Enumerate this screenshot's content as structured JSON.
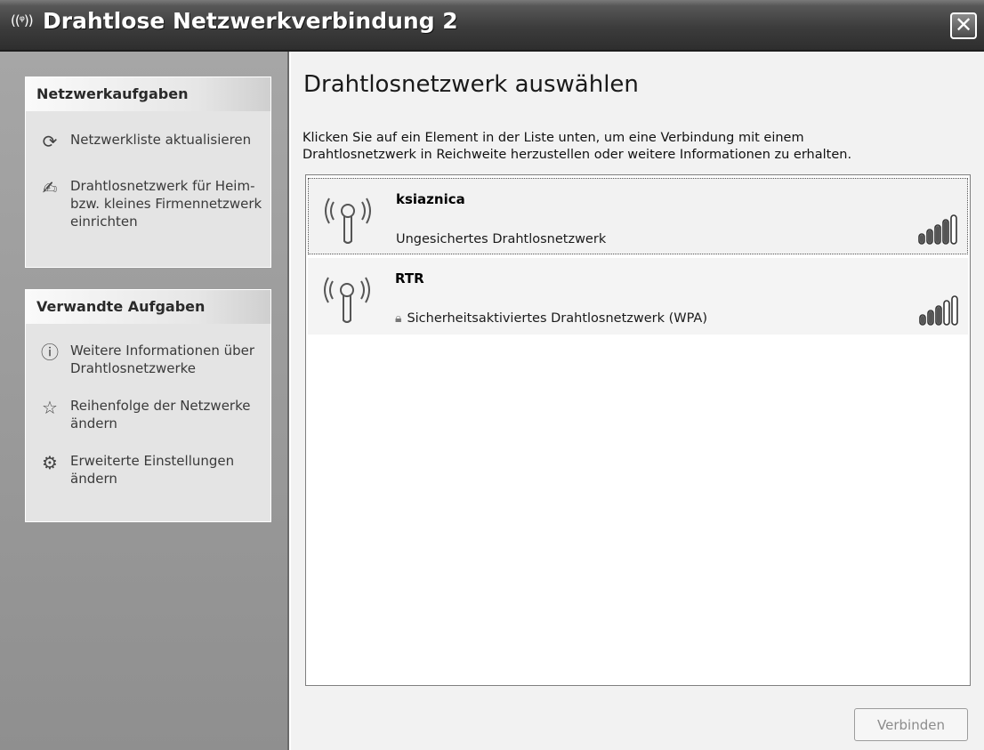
{
  "window": {
    "title": "Drahtlose Netzwerkverbindung 2",
    "title_icon": "((ᵠ))",
    "close_label": "✕"
  },
  "task_groups": [
    {
      "title": "Netzwerkaufgaben",
      "items": [
        {
          "icon": "refresh-icon",
          "glyph": "⟳",
          "label": "Netzwerkliste aktualisieren"
        },
        {
          "icon": "wireless-setup-icon",
          "glyph": "✍",
          "label": "Drahtlosnetzwerk für Heim- bzw. kleines Firmennetzwerk einrichten"
        }
      ]
    },
    {
      "title": "Verwandte Aufgaben",
      "items": [
        {
          "icon": "info-icon",
          "glyph": "ⓘ",
          "label": "Weitere Informationen über Drahtlosnetzwerke"
        },
        {
          "icon": "star-icon",
          "glyph": "☆",
          "label": "Reihenfolge der Netzwerke ändern"
        },
        {
          "icon": "settings-icon",
          "glyph": "⚙",
          "label": "Erweiterte Einstellungen ändern"
        }
      ]
    }
  ],
  "main": {
    "heading": "Drahtlosnetzwerk auswählen",
    "description_line1": "Klicken Sie auf ein Element in der Liste unten, um eine Verbindung mit einem",
    "description_line2": "Drahtlosnetzwerk in Reichweite herzustellen oder weitere Informationen zu erhalten.",
    "networks": [
      {
        "name": "ksiaznica",
        "status": "Ungesichertes Drahtlosnetzwerk",
        "secured": false,
        "signal_bars": 4,
        "selected": true
      },
      {
        "name": "RTR",
        "status": "Sicherheitsaktiviertes Drahtlosnetzwerk (WPA)",
        "secured": true,
        "signal_bars": 3,
        "selected": false
      }
    ],
    "connect_label": "Verbinden"
  }
}
